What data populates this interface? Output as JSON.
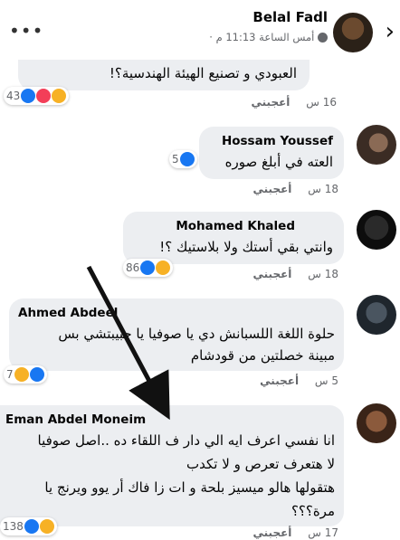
{
  "header": {
    "more_icon": "more-dots-icon",
    "name": "Belal Fadl",
    "meta": "أمس الساعة 11:13 م ·",
    "back_icon": "chevron-right-icon"
  },
  "comments": [
    {
      "name": "",
      "text": "العبودي و تصنيع الهيئة الهندسية؟!",
      "time": "16 س",
      "like": "أعجبني",
      "reactions": {
        "count": "43",
        "icons": [
          "like-reaction-icon",
          "love-reaction-icon",
          "haha-reaction-icon"
        ]
      }
    },
    {
      "name": "Hossam Youssef",
      "text": "العته في أبلغ صوره",
      "time": "18 س",
      "like": "أعجبني",
      "reactions": {
        "count": "5",
        "icons": [
          "like-reaction-icon"
        ]
      }
    },
    {
      "name": "Mohamed Khaled",
      "text": "وانتي بقي أستك ولا بلاستيك ؟!",
      "time": "18 س",
      "like": "أعجبني",
      "reactions": {
        "count": "86",
        "icons": [
          "like-reaction-icon",
          "haha-reaction-icon"
        ]
      }
    },
    {
      "name": "Ahmed Abdeel",
      "text1": "حلوة اللغة اللسبانش دي يا صوفيا يا حبيبتشي بس",
      "text2": "مبينة خصلتين من قودشام",
      "time": "5 س",
      "like": "أعجبني",
      "reactions": {
        "count": "7",
        "icons": [
          "like-reaction-icon",
          "haha-reaction-icon"
        ]
      }
    },
    {
      "name": "Eman Abdel Moneim",
      "text1": "انا نفسي اعرف ايه الي دار ف اللقاء ده ..اصل صوفيا",
      "text2": "لا هتعرف تعرص و لا تكدب",
      "text3": "هتقولها هالو ميسيز بلحة و ات زا فاك أر يوو ويرنج يا",
      "text4": "مرة؟؟؟",
      "time": "17 س",
      "like": "أعجبني",
      "reactions": {
        "count": "138",
        "icons": [
          "like-reaction-icon",
          "haha-reaction-icon"
        ]
      }
    }
  ]
}
